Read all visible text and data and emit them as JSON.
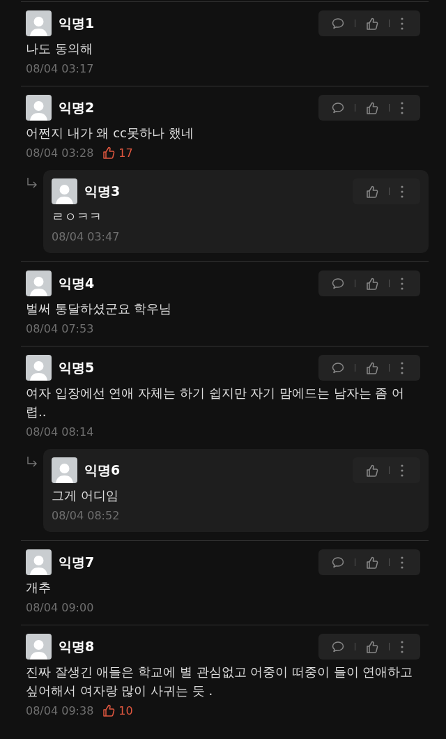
{
  "comments": [
    {
      "author": "익명1",
      "body": "나도 동의해",
      "time": "08/04 03:17"
    },
    {
      "author": "익명2",
      "body": "어쩐지 내가 왜 cc못하나 했네",
      "time": "08/04 03:28",
      "likes": "17",
      "replies": [
        {
          "author": "익명3",
          "body": "ㄹㅇㅋㅋ",
          "time": "08/04 03:47"
        }
      ]
    },
    {
      "author": "익명4",
      "body": "벌써 통달하셨군요 학우님",
      "time": "08/04 07:53"
    },
    {
      "author": "익명5",
      "body": "여자 입장에선 연애 자체는 하기 쉽지만 자기 맘에드는 남자는 좀 어렵..",
      "time": "08/04 08:14",
      "replies": [
        {
          "author": "익명6",
          "body": "그게 어디임",
          "time": "08/04 08:52"
        }
      ]
    },
    {
      "author": "익명7",
      "body": "개추",
      "time": "08/04 09:00"
    },
    {
      "author": "익명8",
      "body": "진짜 잘생긴 애들은 학교에 별 관심없고 어중이 떠중이 들이 연애하고 싶어해서 여자랑 많이 사귀는 듯 .",
      "time": "08/04 09:38",
      "likes": "10"
    }
  ]
}
